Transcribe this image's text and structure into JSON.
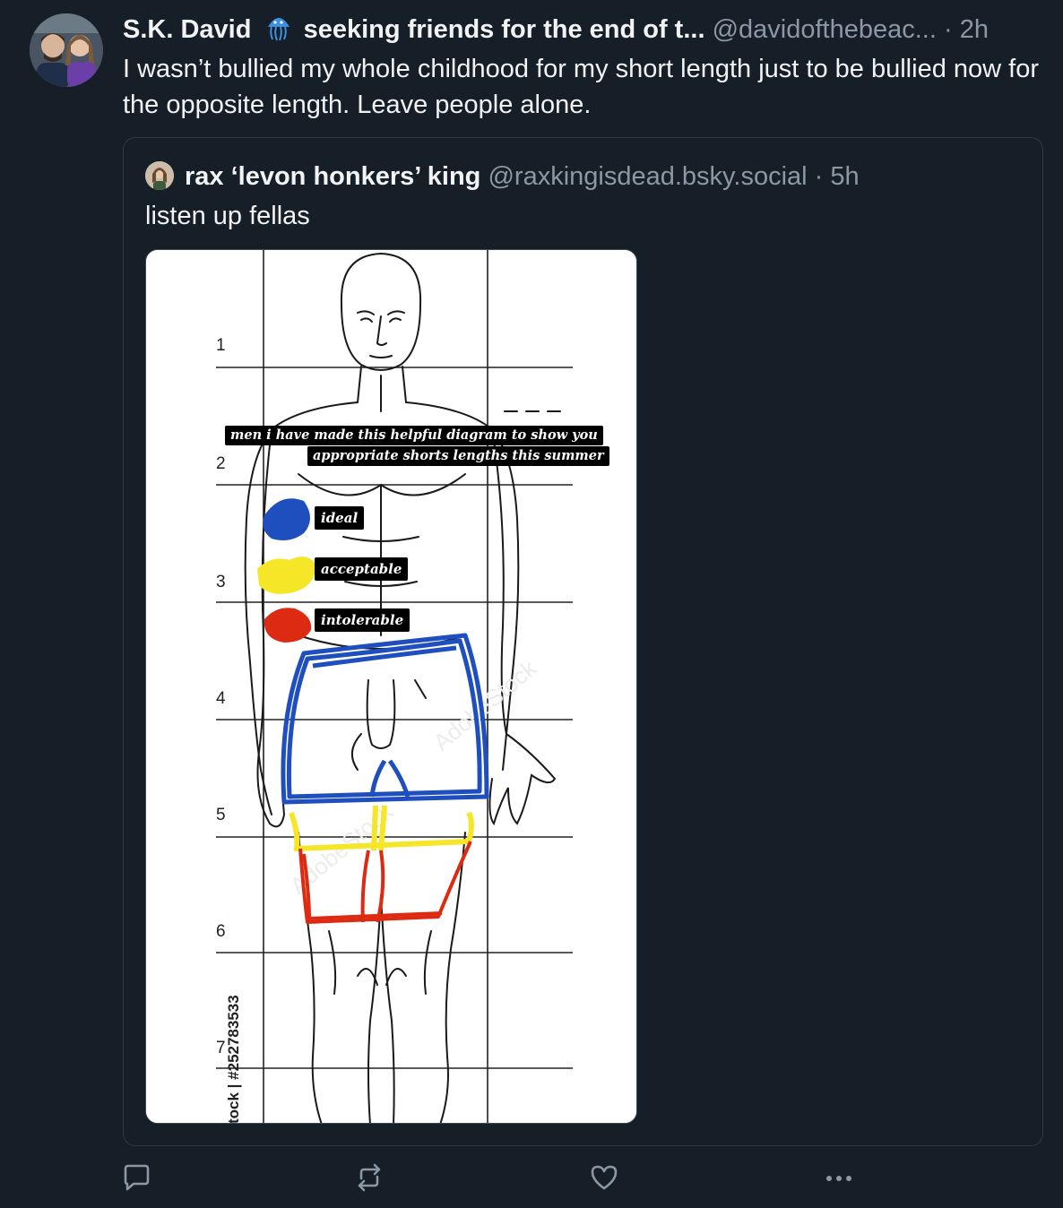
{
  "post": {
    "author_name": "S.K. David",
    "author_emoji": "jellyfish-icon",
    "display_suffix": "seeking friends for the end of t...",
    "handle": "@davidofthebeac...",
    "separator": "·",
    "time": "2h",
    "text": "I wasn’t bullied my whole childhood for my short length just to be bullied now for the opposite length. Leave people alone."
  },
  "quote": {
    "author_name": "rax ‘levon honkers’ king",
    "handle": "@raxkingisdead.bsky.social",
    "separator": "·",
    "time": "5h",
    "text": "listen up fellas",
    "image": {
      "caption_line1": "men i have made this helpful diagram to show you",
      "caption_line2": "appropriate shorts lengths this summer",
      "labels": [
        "ideal",
        "acceptable",
        "intolerable"
      ],
      "label_colors": [
        "#1f4fbf",
        "#f5e628",
        "#dd2a12"
      ],
      "row_numbers": [
        "1",
        "2",
        "3",
        "4",
        "5",
        "6",
        "7"
      ],
      "watermark": "tock | #252783533"
    }
  },
  "actions": {
    "reply_icon": "reply-icon",
    "repost_icon": "repost-icon",
    "like_icon": "heart-icon",
    "more_icon": "more-icon"
  },
  "colors": {
    "background": "#161e27",
    "muted": "#8b98a5",
    "border": "#2e3a48"
  }
}
